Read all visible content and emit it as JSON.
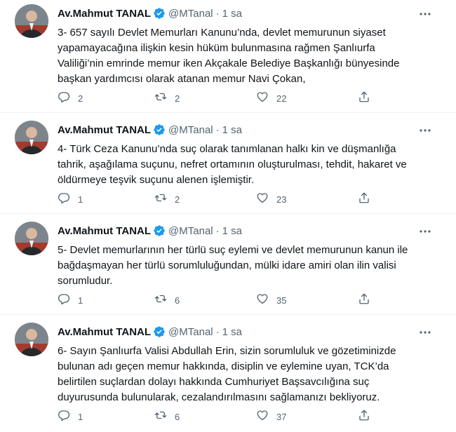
{
  "colors": {
    "text": "#0f1419",
    "secondary": "#536471",
    "verified": "#1d9bf0",
    "divider": "#eff3f4"
  },
  "icons": {
    "reply": "reply-icon",
    "retweet": "retweet-icon",
    "like": "like-icon",
    "share": "share-icon",
    "more": "more-icon",
    "verified": "verified-badge-icon"
  },
  "tweets": [
    {
      "name": "Av.Mahmut TANAL",
      "handle": "@MTanal",
      "separator": "·",
      "time": "1 sa",
      "text": "3- 657 sayılı Devlet Memurları Kanunu’nda, devlet memurunun siyaset\nyapamayacağına ilişkin kesin hüküm bulunmasına rağmen Şanlıurfa\nValiliği’nin emrinde memur iken Akçakale Belediye Başkanlığı bünyesinde\nbaşkan yardımcısı olarak atanan memur Navi Çokan,",
      "replies": "2",
      "retweets": "2",
      "likes": "22"
    },
    {
      "name": "Av.Mahmut TANAL",
      "handle": "@MTanal",
      "separator": "·",
      "time": "1 sa",
      "text": "4- Türk Ceza Kanunu’nda suç olarak tanımlanan halkı kin ve düşmanlığa\ntahrik, aşağılama suçunu, nefret ortamının oluşturulması, tehdit, hakaret ve\nöldürmeye teşvik suçunu alenen işlemiştir.",
      "replies": "1",
      "retweets": "2",
      "likes": "23"
    },
    {
      "name": "Av.Mahmut TANAL",
      "handle": "@MTanal",
      "separator": "·",
      "time": "1 sa",
      "text": "5- Devlet memurlarının her türlü suç eylemi ve devlet memurunun kanun ile\nbağdaşmayan her türlü sorumluluğundan, mülki idare amiri olan ilin valisi\nsorumludur.",
      "replies": "1",
      "retweets": "6",
      "likes": "35"
    },
    {
      "name": "Av.Mahmut TANAL",
      "handle": "@MTanal",
      "separator": "·",
      "time": "1 sa",
      "text": "6- Sayın Şanlıurfa Valisi Abdullah Erin, sizin sorumluluk ve gözetiminizde\nbulunan adı geçen memur hakkında, disiplin ve eylemine uyan, TCK’da\nbelirtilen suçlardan dolayı hakkında Cumhuriyet Başsavcılığına suç\nduyurusunda bulunularak, cezalandırılmasını sağlamanızı bekliyoruz.",
      "replies": "1",
      "retweets": "6",
      "likes": "37"
    }
  ]
}
